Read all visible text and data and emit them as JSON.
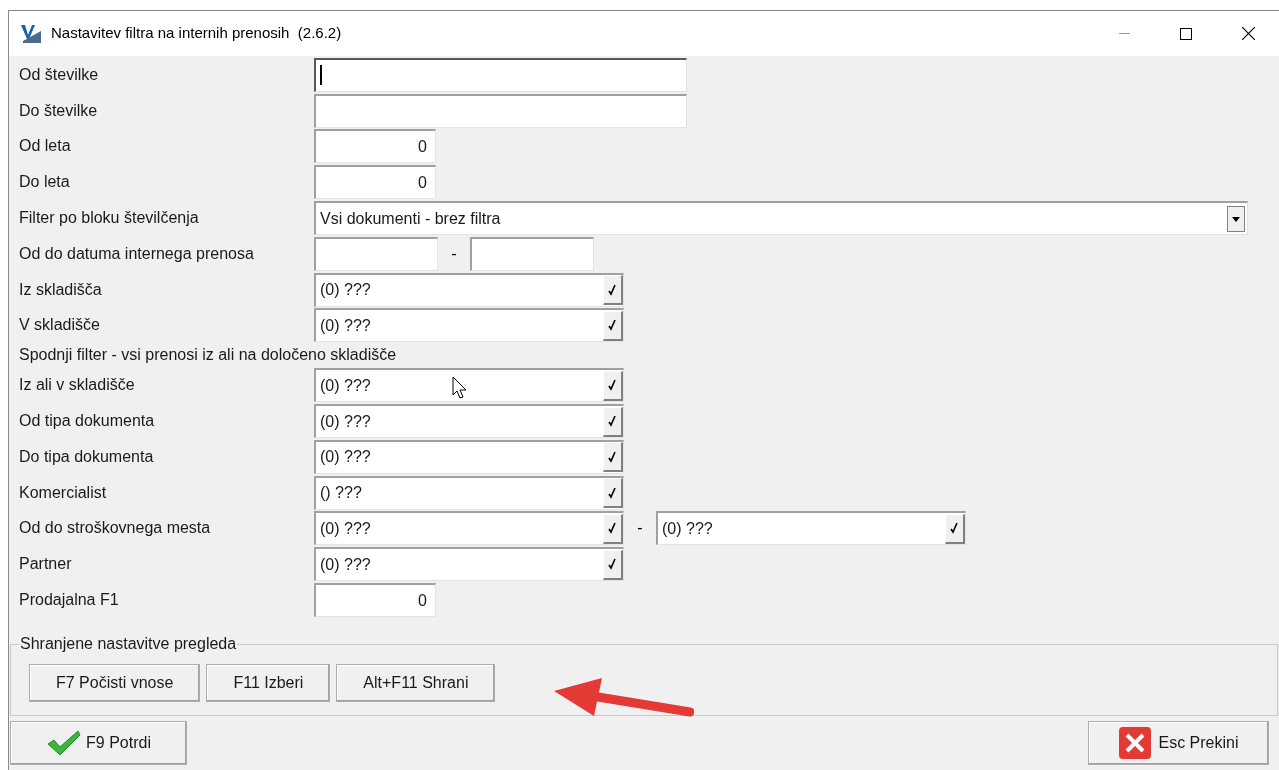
{
  "window": {
    "title": "Nastavitev filtra na internih prenosih  (2.6.2)"
  },
  "fields": [
    {
      "kind": "text",
      "label": "Od številke",
      "focused": true
    },
    {
      "kind": "text",
      "label": "Do številke",
      "focused": false
    },
    {
      "kind": "number",
      "label": "Od leta",
      "value": "0"
    },
    {
      "kind": "number",
      "label": "Do leta",
      "value": "0"
    },
    {
      "kind": "select",
      "label": "Filter po bloku številčenja",
      "value": "Vsi dokumenti - brez filtra"
    },
    {
      "kind": "daterange",
      "label": "Od do datuma internega prenosa",
      "separator": "-"
    },
    {
      "kind": "lookup",
      "label": "Iz skladišča",
      "value": "(0) ???"
    },
    {
      "kind": "lookup",
      "label": "V skladišče",
      "value": "(0) ???"
    },
    {
      "kind": "note",
      "label": "Spodnji filter - vsi prenosi iz ali na določeno skladišče"
    },
    {
      "kind": "lookup",
      "label": "Iz ali v skladišče",
      "value": "(0) ???"
    },
    {
      "kind": "lookup",
      "label": "Od tipa dokumenta",
      "value": "(0) ???"
    },
    {
      "kind": "lookup",
      "label": "Do tipa dokumenta",
      "value": "(0) ???"
    },
    {
      "kind": "lookup",
      "label": "Komercialist",
      "value": "() ???"
    },
    {
      "kind": "lookuprange",
      "label": "Od do stroškovnega mesta",
      "values": [
        "(0) ???",
        "(0) ???"
      ],
      "separator": "-"
    },
    {
      "kind": "lookup",
      "label": "Partner",
      "value": "(0) ???"
    },
    {
      "kind": "number",
      "label": "Prodajalna F1",
      "value": "0"
    }
  ],
  "saved_settings": {
    "title": "Shranjene nastavitve pregleda",
    "buttons": [
      "F7 Počisti vnose",
      "F11 Izberi",
      "Alt+F11 Shrani"
    ]
  },
  "footer": {
    "confirm": "F9 Potrdi",
    "cancel": "Esc Prekini"
  }
}
